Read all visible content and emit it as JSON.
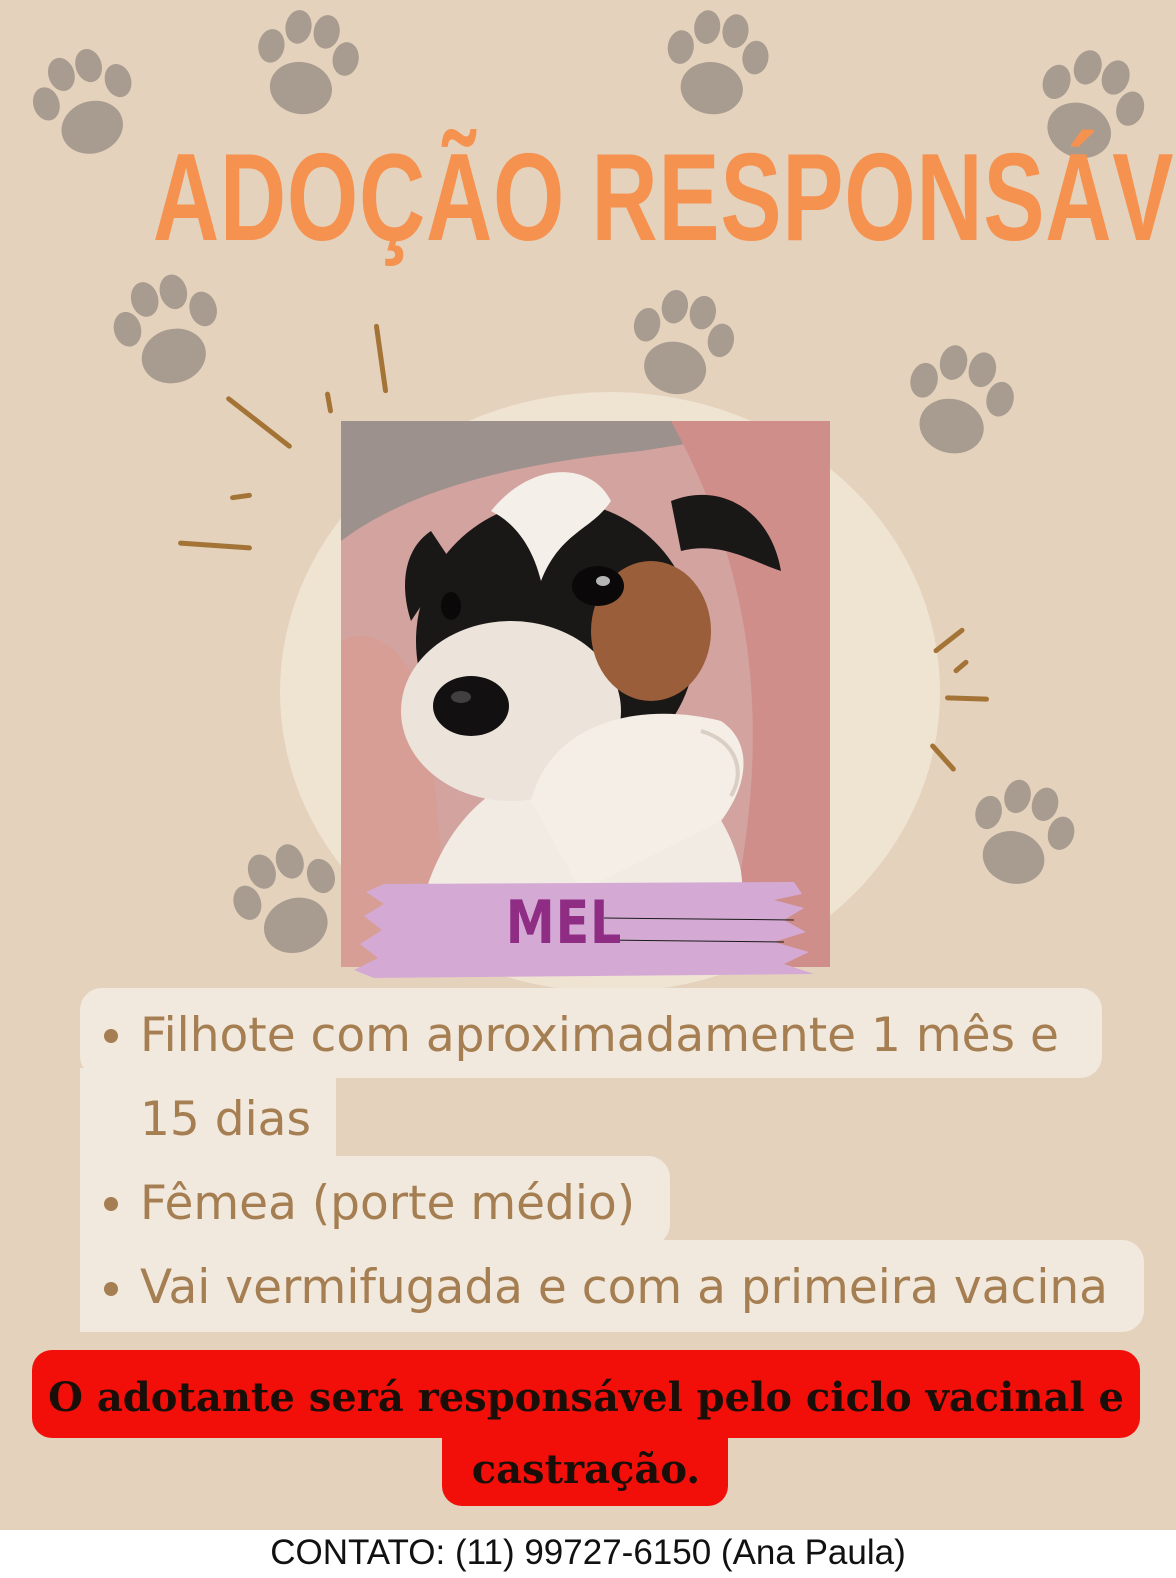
{
  "poster": {
    "title": "ADOÇÃO RESPONSÁVEL",
    "pet_name": "MEL",
    "photo_alt": "",
    "info_lines": [
      "Filhote com aproximadamente 1 mês e",
      "15 dias",
      "Fêmea (porte médio)",
      "Vai vermifugada e com a primeira vacina"
    ],
    "notice_line1": "O adotante será responsável pelo ciclo vacinal e",
    "notice_line2": "castração.",
    "contact": "CONTATO: (11) 99727-6150 (Ana Paula)"
  },
  "colors": {
    "background": "#e4d2bc",
    "title": "#f59250",
    "paw": "#a89b8f",
    "name_band": "#d4aad5",
    "name_text": "#8f2c83",
    "info_text": "#a57e52",
    "notice_bg": "#f20f0a"
  },
  "icons": [
    "paw-print-icon",
    "bullet-dot-icon"
  ]
}
